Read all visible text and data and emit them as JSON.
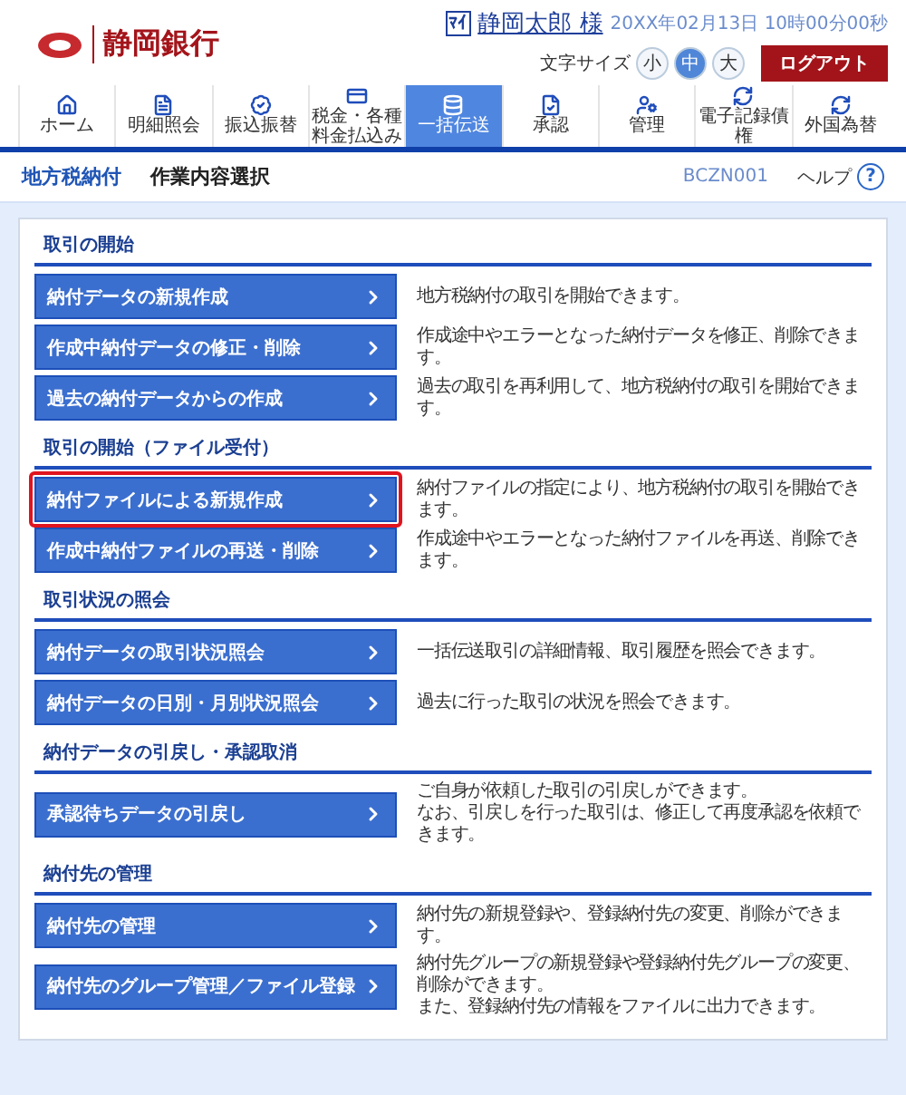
{
  "header": {
    "bank_name": "静岡銀行",
    "user_badge": "ﾏｲ",
    "user_name": "静岡太郎 様",
    "datetime": "20XX年02月13日 10時00分00秒",
    "font_size_label": "文字サイズ",
    "font_sizes": [
      {
        "label": "小",
        "selected": false
      },
      {
        "label": "中",
        "selected": true
      },
      {
        "label": "大",
        "selected": false
      }
    ],
    "logout": "ログアウト"
  },
  "nav": [
    {
      "label": "ホーム",
      "selected": false
    },
    {
      "label": "明細照会",
      "selected": false
    },
    {
      "label": "振込振替",
      "selected": false
    },
    {
      "label": "税金・各種料金払込み",
      "selected": false
    },
    {
      "label": "一括伝送",
      "selected": true
    },
    {
      "label": "承認",
      "selected": false
    },
    {
      "label": "管理",
      "selected": false
    },
    {
      "label": "電子記録債権",
      "selected": false
    },
    {
      "label": "外国為替",
      "selected": false
    }
  ],
  "breadcrumb": {
    "category": "地方税納付",
    "page_title": "作業内容選択",
    "screen_id": "BCZN001",
    "help": "ヘルプ",
    "help_icon": "?"
  },
  "sections": [
    {
      "title": "取引の開始",
      "items": [
        {
          "button": "納付データの新規作成",
          "description": "地方税納付の取引を開始できます。",
          "highlighted": false
        },
        {
          "button": "作成中納付データの修正・削除",
          "description": "作成途中やエラーとなった納付データを修正、削除できます。",
          "highlighted": false
        },
        {
          "button": "過去の納付データからの作成",
          "description": "過去の取引を再利用して、地方税納付の取引を開始できます。",
          "highlighted": false
        }
      ]
    },
    {
      "title": "取引の開始（ファイル受付）",
      "items": [
        {
          "button": "納付ファイルによる新規作成",
          "description": "納付ファイルの指定により、地方税納付の取引を開始できます。",
          "highlighted": true
        },
        {
          "button": "作成中納付ファイルの再送・削除",
          "description": "作成途中やエラーとなった納付ファイルを再送、削除できます。",
          "highlighted": false
        }
      ]
    },
    {
      "title": "取引状況の照会",
      "items": [
        {
          "button": "納付データの取引状況照会",
          "description": "一括伝送取引の詳細情報、取引履歴を照会できます。",
          "highlighted": false
        },
        {
          "button": "納付データの日別・月別状況照会",
          "description": "過去に行った取引の状況を照会できます。",
          "highlighted": false
        }
      ]
    },
    {
      "title": "納付データの引戻し・承認取消",
      "items": [
        {
          "button": "承認待ちデータの引戻し",
          "description": "ご自身が依頼した取引の引戻しができます。",
          "description_2": "なお、引戻しを行った取引は、修正して再度承認を依頼できます。",
          "highlighted": false
        }
      ]
    },
    {
      "title": "納付先の管理",
      "items": [
        {
          "button": "納付先の管理",
          "description": "納付先の新規登録や、登録納付先の変更、削除ができます。",
          "highlighted": false
        },
        {
          "button": "納付先のグループ管理／ファイル登録",
          "description": "納付先グループの新規登録や登録納付先グループの変更、削除ができます。",
          "description_2": "また、登録納付先の情報をファイルに出力できます。",
          "highlighted": false
        }
      ]
    }
  ]
}
